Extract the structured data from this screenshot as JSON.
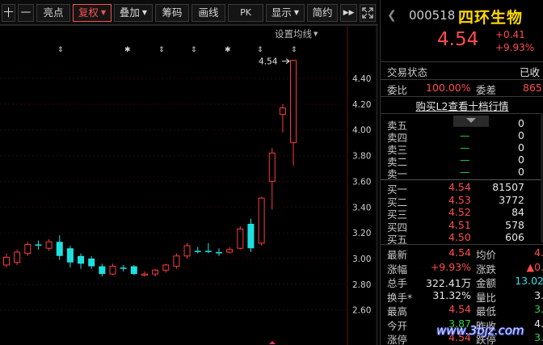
{
  "toolbar": {
    "plus": "十",
    "minus": "一",
    "highlight": "亮点",
    "restore_rights": "复权",
    "overlay": "叠加",
    "chips": "筹码",
    "drawline": "画线",
    "pk": "PK",
    "display": "显示",
    "simple": "简约",
    "more": "▶▶"
  },
  "chart": {
    "settings_label": "设置均线",
    "price_marker": "4.54",
    "y_labels": [
      "4.40",
      "4.20",
      "4.00",
      "3.80",
      "3.60",
      "3.40",
      "3.20",
      "3.00",
      "2.80",
      "2.60"
    ]
  },
  "chart_data": {
    "type": "candlestick",
    "ylim": [
      2.55,
      4.6
    ],
    "y_ticks": [
      4.4,
      4.2,
      4.0,
      3.8,
      3.6,
      3.4,
      3.2,
      3.0,
      2.8,
      2.6
    ],
    "last_price_label": "4.54",
    "candles": [
      {
        "o": 2.95,
        "c": 3.01,
        "h": 3.04,
        "l": 2.93,
        "up": true
      },
      {
        "o": 2.97,
        "c": 3.05,
        "h": 3.07,
        "l": 2.95,
        "up": true
      },
      {
        "o": 3.04,
        "c": 3.11,
        "h": 3.13,
        "l": 3.02,
        "up": true
      },
      {
        "o": 3.11,
        "c": 3.1,
        "h": 3.14,
        "l": 3.07,
        "up": false
      },
      {
        "o": 3.08,
        "c": 3.13,
        "h": 3.15,
        "l": 3.06,
        "up": true
      },
      {
        "o": 3.13,
        "c": 3.02,
        "h": 3.18,
        "l": 2.99,
        "up": false
      },
      {
        "o": 3.08,
        "c": 2.97,
        "h": 3.1,
        "l": 2.93,
        "up": false
      },
      {
        "o": 3.02,
        "c": 2.96,
        "h": 3.04,
        "l": 2.92,
        "up": false
      },
      {
        "o": 3.0,
        "c": 2.94,
        "h": 3.02,
        "l": 2.92,
        "up": false
      },
      {
        "o": 2.94,
        "c": 2.88,
        "h": 2.96,
        "l": 2.86,
        "up": false
      },
      {
        "o": 2.88,
        "c": 2.94,
        "h": 2.96,
        "l": 2.87,
        "up": true
      },
      {
        "o": 2.93,
        "c": 2.92,
        "h": 2.95,
        "l": 2.9,
        "up": false
      },
      {
        "o": 2.94,
        "c": 2.88,
        "h": 2.95,
        "l": 2.87,
        "up": false
      },
      {
        "o": 2.88,
        "c": 2.88,
        "h": 2.9,
        "l": 2.86,
        "up": true
      },
      {
        "o": 2.88,
        "c": 2.91,
        "h": 2.92,
        "l": 2.86,
        "up": true
      },
      {
        "o": 2.91,
        "c": 2.95,
        "h": 2.96,
        "l": 2.89,
        "up": true
      },
      {
        "o": 2.94,
        "c": 3.02,
        "h": 3.04,
        "l": 2.92,
        "up": true
      },
      {
        "o": 3.02,
        "c": 3.1,
        "h": 3.12,
        "l": 3.0,
        "up": true
      },
      {
        "o": 3.06,
        "c": 3.06,
        "h": 3.09,
        "l": 3.04,
        "up": false
      },
      {
        "o": 3.06,
        "c": 3.06,
        "h": 3.12,
        "l": 3.04,
        "up": false
      },
      {
        "o": 3.05,
        "c": 3.05,
        "h": 3.08,
        "l": 3.02,
        "up": false
      },
      {
        "o": 3.05,
        "c": 3.07,
        "h": 3.09,
        "l": 3.04,
        "up": true
      },
      {
        "o": 3.08,
        "c": 3.23,
        "h": 3.25,
        "l": 3.07,
        "up": true
      },
      {
        "o": 3.27,
        "c": 3.08,
        "h": 3.31,
        "l": 3.05,
        "up": false
      },
      {
        "o": 3.12,
        "c": 3.47,
        "h": 3.48,
        "l": 3.1,
        "up": true
      },
      {
        "o": 3.6,
        "c": 3.82,
        "h": 3.86,
        "l": 3.38,
        "up": true
      },
      {
        "o": 4.12,
        "c": 4.17,
        "h": 4.2,
        "l": 3.98,
        "up": true
      },
      {
        "o": 3.9,
        "c": 4.54,
        "h": 4.54,
        "l": 3.72,
        "up": true
      }
    ]
  },
  "panel": {
    "code": "000518",
    "name": "四环生物",
    "price": "4.54",
    "change": "+0.41",
    "change_pct": "+9.93%",
    "trade_status_label": "交易状态",
    "trade_status_value": "已收",
    "weibi_label": "委比",
    "weibi_value": "100.00%",
    "weicha_label": "委差",
    "weicha_value": "865",
    "l2_link": "购买L2查看十档行情",
    "sells": [
      {
        "label": "卖五",
        "price": "",
        "vol": "0"
      },
      {
        "label": "卖四",
        "price": "—",
        "vol": "0"
      },
      {
        "label": "卖三",
        "price": "—",
        "vol": "0"
      },
      {
        "label": "卖二",
        "price": "—",
        "vol": "0"
      },
      {
        "label": "卖一",
        "price": "—",
        "vol": "0"
      }
    ],
    "buys": [
      {
        "label": "买一",
        "price": "4.54",
        "vol": "81507"
      },
      {
        "label": "买二",
        "price": "4.53",
        "vol": "3772"
      },
      {
        "label": "买三",
        "price": "4.52",
        "vol": "84"
      },
      {
        "label": "买四",
        "price": "4.51",
        "vol": "578"
      },
      {
        "label": "买五",
        "price": "4.50",
        "vol": "606"
      }
    ],
    "stats": [
      {
        "l1": "最新",
        "v1": "4.54",
        "c1": "red",
        "l2": "均价",
        "v2": "4.",
        "c2": "red"
      },
      {
        "l1": "涨幅",
        "v1": "+9.93%",
        "c1": "red",
        "l2": "涨跌",
        "v2": "▲0.",
        "c2": "red"
      },
      {
        "l1": "总手",
        "v1": "322.41万",
        "c1": "white",
        "l2": "金额",
        "v2": "13.02",
        "c2": "cyan"
      },
      {
        "l1": "换手*",
        "v1": "31.32%",
        "c1": "white",
        "l2": "量比",
        "v2": "3.",
        "c2": "white"
      },
      {
        "l1": "最高",
        "v1": "4.54",
        "c1": "red",
        "l2": "最低",
        "v2": "3.",
        "c2": "green"
      },
      {
        "l1": "今开",
        "v1": "3.87",
        "c1": "green",
        "l2": "昨收",
        "v2": "4.",
        "c2": "white"
      },
      {
        "l1": "涨停",
        "v1": "4.54",
        "c1": "red",
        "l2": "跌停",
        "v2": "3.",
        "c2": "green"
      }
    ]
  },
  "watermark": "www.3bjz.com"
}
